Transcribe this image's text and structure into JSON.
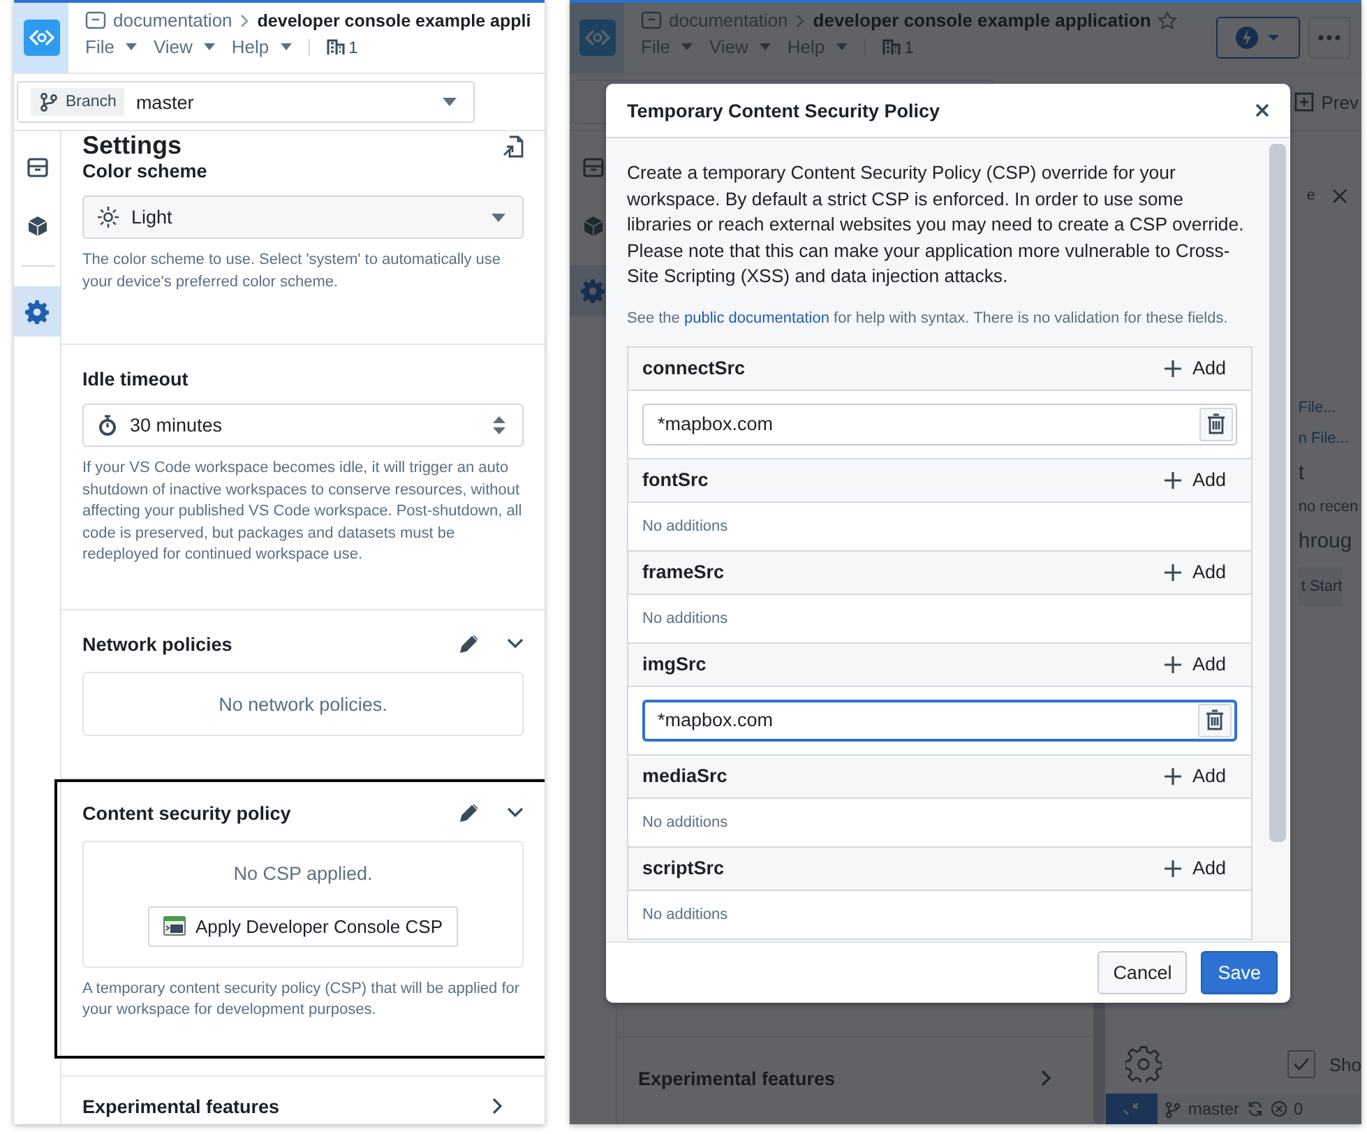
{
  "left_window": {
    "breadcrumb": {
      "parent": "documentation",
      "title": "developer console example appli"
    },
    "menus": [
      "File",
      "View",
      "Help"
    ],
    "building_count": "1",
    "branch": {
      "tag": "Branch",
      "value": "master"
    },
    "rail": [
      {
        "kind": "box",
        "selected": false
      },
      {
        "kind": "cube",
        "selected": false
      },
      {
        "kind": "gear",
        "selected": true
      }
    ],
    "settings": {
      "title": "Settings",
      "sections": [
        {
          "kind": "select",
          "label": "Color scheme",
          "value": "Light",
          "help": "The color scheme to use. Select 'system' to automatically use your device's preferred color scheme."
        },
        {
          "kind": "duration",
          "label": "Idle timeout",
          "value": "30 minutes",
          "help": "If your VS Code workspace becomes idle, it will trigger an auto shutdown of inactive workspaces to conserve resources, without affecting your published VS Code workspace. Post-shutdown, all code is preserved, but packages and datasets must be redeployed for continued workspace use."
        },
        {
          "kind": "panel",
          "label": "Network policies",
          "empty": "No network policies.",
          "highlighted": false
        },
        {
          "kind": "panel",
          "label": "Content security policy",
          "empty": "No CSP applied.",
          "button": "Apply Developer Console CSP",
          "help": "A temporary content security policy (CSP) that will be applied for your workspace for development purposes.",
          "highlighted": true
        },
        {
          "kind": "nav",
          "label": "Experimental features"
        }
      ]
    }
  },
  "right_window": {
    "breadcrumb": {
      "parent": "documentation",
      "title": "developer console example application"
    },
    "menus": [
      "File",
      "View",
      "Help"
    ],
    "building_count": "1",
    "preview_fragment": "Prev",
    "tab_fragment": "e",
    "fragments": [
      "File...",
      "n File..."
    ],
    "heading_fragment": "t",
    "recent_fragment": "no recen",
    "walkthrough_fragment": "hroug",
    "start_fragment": "t Start",
    "experimental": "Experimental features",
    "checkbox": {
      "label": "Sho",
      "checked": true
    },
    "status": {
      "branch": "master",
      "errors": "0"
    },
    "dialog": {
      "title": "Temporary Content Security Policy",
      "intro": "Create a temporary Content Security Policy (CSP) override for your workspace. By default a strict CSP is enforced. In order to use some libraries or reach external websites you may need to create a CSP override. Please note that this can make your application more vulnerable to Cross-Site Scripting (XSS) and data injection attacks.",
      "note_before": "See the ",
      "link": "public documentation",
      "note_after": " for help with syntax. There is no validation for these fields.",
      "directives": [
        {
          "name": "connectSrc",
          "add": "Add",
          "values": [
            {
              "value": "*mapbox.com",
              "focused": false
            }
          ]
        },
        {
          "name": "fontSrc",
          "add": "Add",
          "empty": "No additions"
        },
        {
          "name": "frameSrc",
          "add": "Add",
          "empty": "No additions"
        },
        {
          "name": "imgSrc",
          "add": "Add",
          "values": [
            {
              "value": "*mapbox.com",
              "focused": true
            }
          ]
        },
        {
          "name": "mediaSrc",
          "add": "Add",
          "empty": "No additions"
        },
        {
          "name": "scriptSrc",
          "add": "Add",
          "empty": "No additions"
        }
      ],
      "cancel": "Cancel",
      "save": "Save"
    }
  }
}
